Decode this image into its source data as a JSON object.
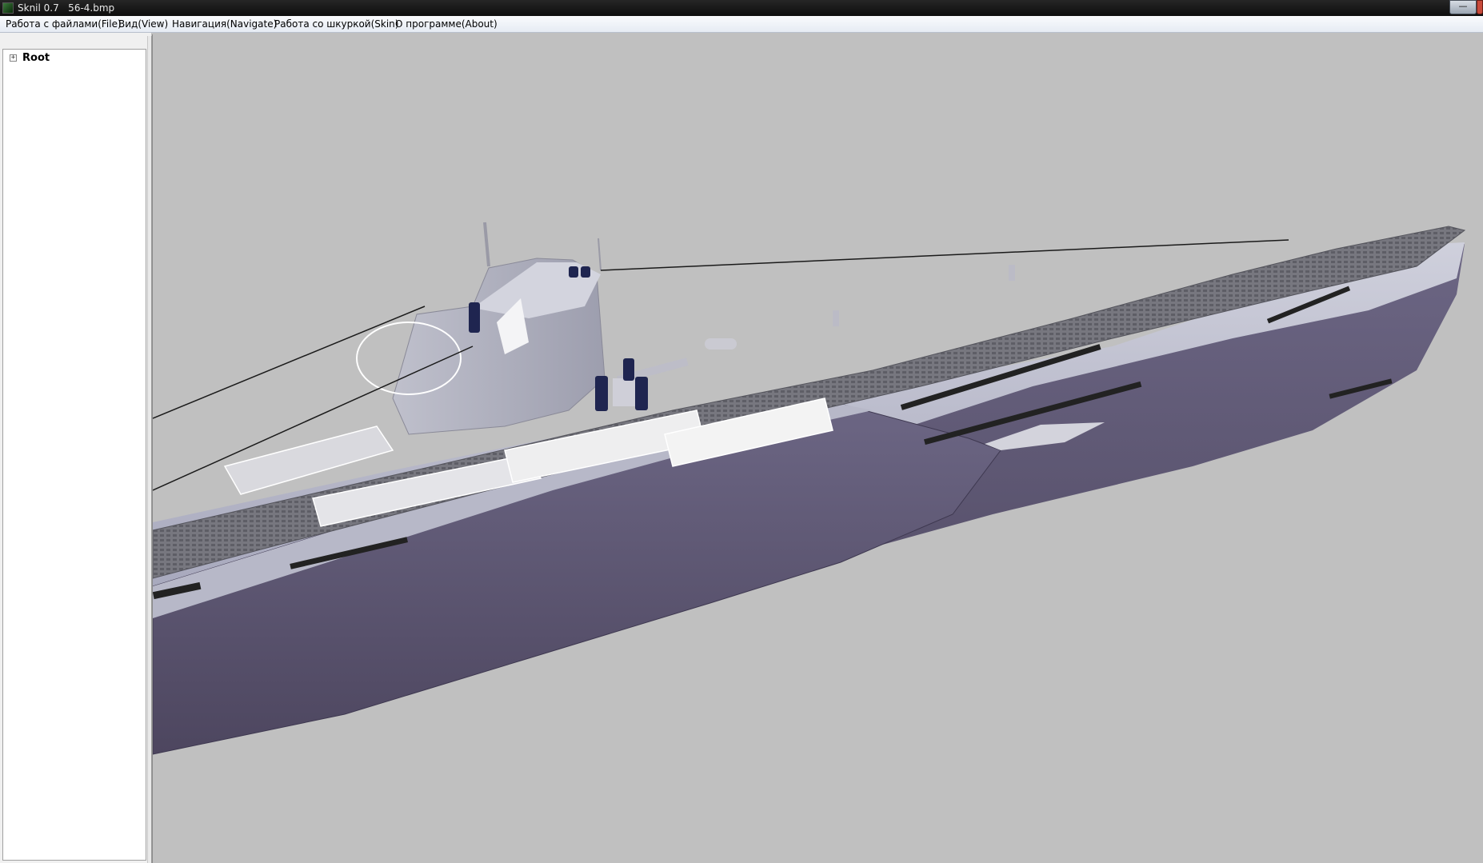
{
  "window": {
    "title": "Sknil 0.7   56-4.bmp",
    "icon": "app-icon",
    "buttons": [
      "minimize-icon",
      "close-icon"
    ]
  },
  "menu": {
    "file": "Работа с файлами(File)",
    "view": "Вид(View)",
    "navigate": "Навигация(Navigate)",
    "skin": "Работа со шкуркой(Skin)",
    "about": "О программе(About)"
  },
  "tree": {
    "root_label": "Root",
    "root_expander": "+"
  },
  "viewport": {
    "background": "#c0c0c0",
    "model": "submarine-3d-model"
  },
  "colors": {
    "hull_upper": "#a9a9c0",
    "hull_lower": "#5b5470",
    "deck": "#6d6d78"
  }
}
